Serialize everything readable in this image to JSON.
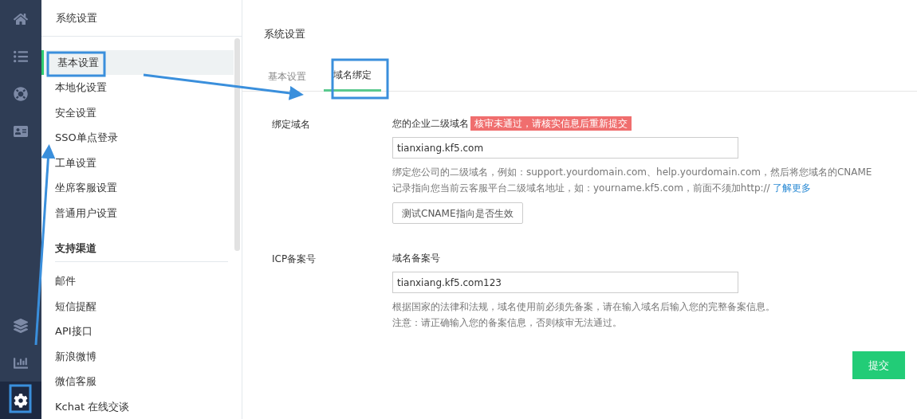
{
  "rail": {
    "items": [
      {
        "kind": "home",
        "selected": false
      },
      {
        "kind": "list",
        "selected": false
      },
      {
        "kind": "support",
        "selected": false
      },
      {
        "kind": "contact",
        "selected": false
      },
      {
        "kind": "layers",
        "selected": false
      },
      {
        "kind": "chart",
        "selected": false
      },
      {
        "kind": "settings",
        "selected": true
      }
    ]
  },
  "sidebar": {
    "title": "系统设置",
    "groups": [
      {
        "items": [
          {
            "label": "基本设置",
            "selected": true
          },
          {
            "label": "本地化设置",
            "selected": false
          },
          {
            "label": "安全设置",
            "selected": false
          },
          {
            "label": "SSO单点登录",
            "selected": false
          },
          {
            "label": "工单设置",
            "selected": false
          },
          {
            "label": "坐席客服设置",
            "selected": false
          },
          {
            "label": "普通用户设置",
            "selected": false
          }
        ]
      },
      {
        "heading": "支持渠道",
        "items": [
          {
            "label": "邮件",
            "selected": false
          },
          {
            "label": "短信提醒",
            "selected": false
          },
          {
            "label": "API接口",
            "selected": false
          },
          {
            "label": "新浪微博",
            "selected": false
          },
          {
            "label": "微信客服",
            "selected": false
          },
          {
            "label": "Kchat 在线交谈",
            "selected": false
          }
        ]
      }
    ]
  },
  "main": {
    "title": "系统设置",
    "tabs": [
      {
        "label": "基本设置",
        "selected": false
      },
      {
        "label": "域名绑定",
        "selected": true
      }
    ],
    "sections": [
      {
        "label": "绑定域名",
        "field_label": "您的企业二级域名",
        "error_badge": "核审未通过，请核实信息后重新提交",
        "value": "tianxiang.kf5.com",
        "help": [
          "绑定您公司的二级域名，例如：support.yourdomain.com、help.yourdomain.com，然后将您域名的CNAME",
          "记录指向您当前云客服平台二级域名地址，如：yourname.kf5.com，前面不须加http://"
        ],
        "help_link": "了解更多",
        "button": "测试CNAME指向是否生效"
      },
      {
        "label": "ICP备案号",
        "field_label": "域名备案号",
        "value": "tianxiang.kf5.com123",
        "help": [
          "根据国家的法律和法规，域名使用前必须先备案，请在输入域名后输入您的完整备案信息。",
          "注意：请正确输入您的备案信息，否则核审无法通过。"
        ]
      }
    ],
    "submit": "提交"
  }
}
